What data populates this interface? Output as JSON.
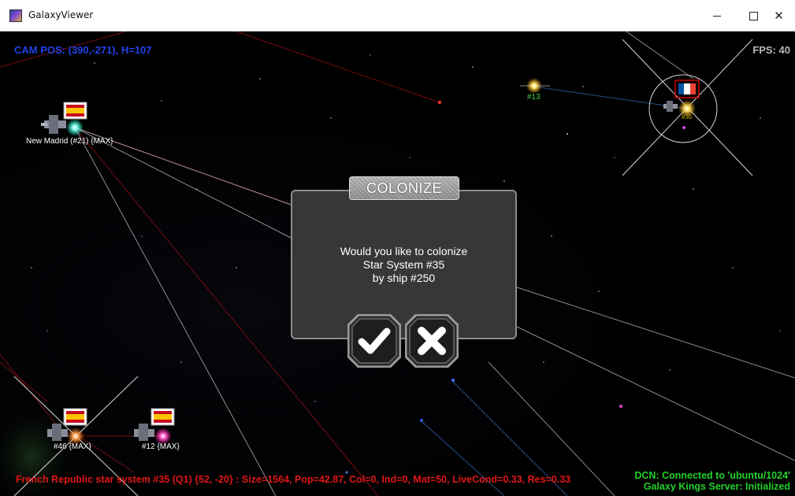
{
  "window": {
    "title": "GalaxyViewer",
    "controls": {
      "minimize": "–",
      "maximize": "☐",
      "close": "✕"
    }
  },
  "hud": {
    "cam_pos": "CAM POS: (390,-271), H=107",
    "fps": "FPS: 40",
    "status": "French Republic star system #35 (Q1)  {52, -20}  :  Size=1564, Pop=42.87, Col=0, Ind=0, Mat=50, LiveCond=0.33, Res=0.33",
    "connection_line1": "DCN: Connected to 'ubuntu/1024'",
    "connection_line2": "Galaxy Kings Server: Initialized"
  },
  "stars": {
    "new_madrid": "New Madrid (#21) {MAX}",
    "s13": "#13",
    "s46": "#46 {MAX}",
    "s12": "#12 {MAX}",
    "s35": "#35"
  },
  "dialog": {
    "title": "COLONIZE",
    "line1": "Would you like to colonize",
    "line2": "Star System #35",
    "line3": "by ship  #250",
    "confirm_icon": "check-icon",
    "cancel_icon": "x-icon"
  },
  "colors": {
    "cam_text": "#2342e6",
    "fps_text": "#b8b8b8",
    "status_text": "#e01616",
    "connection_text": "#23d12a",
    "spain_flag_red": "#c60b1e",
    "spain_flag_yellow": "#ffc400",
    "france_blue": "#0055a4",
    "france_red": "#ef4135"
  }
}
